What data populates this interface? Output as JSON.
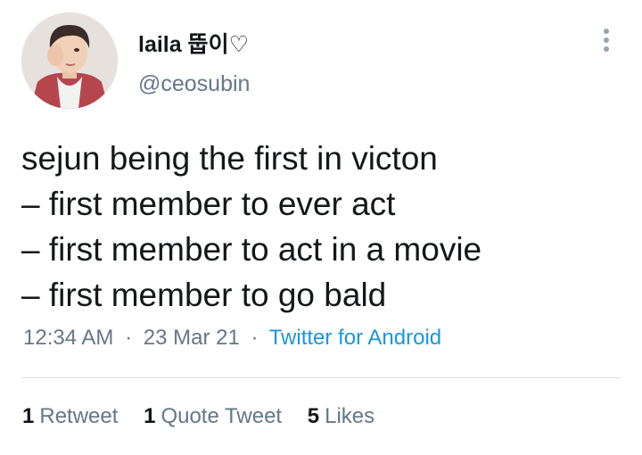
{
  "user": {
    "display_name": "laila 뚭이♡",
    "handle": "@ceosubin"
  },
  "tweet": {
    "lines": [
      "sejun being the first in victon",
      "– first member to ever act",
      "– first member to act in a movie",
      "– first member to go bald"
    ]
  },
  "meta": {
    "time": "12:34 AM",
    "separator": "·",
    "date": "23 Mar 21",
    "source": "Twitter for Android"
  },
  "stats": {
    "retweets": {
      "count": "1",
      "label": "Retweet"
    },
    "quotes": {
      "count": "1",
      "label": "Quote Tweet"
    },
    "likes": {
      "count": "5",
      "label": "Likes"
    }
  },
  "colors": {
    "primary_text": "#14171a",
    "secondary_text": "#657786",
    "link": "#1b95e0",
    "divider": "#d8dee3"
  },
  "icons": {
    "more": "more-vertical-icon"
  }
}
